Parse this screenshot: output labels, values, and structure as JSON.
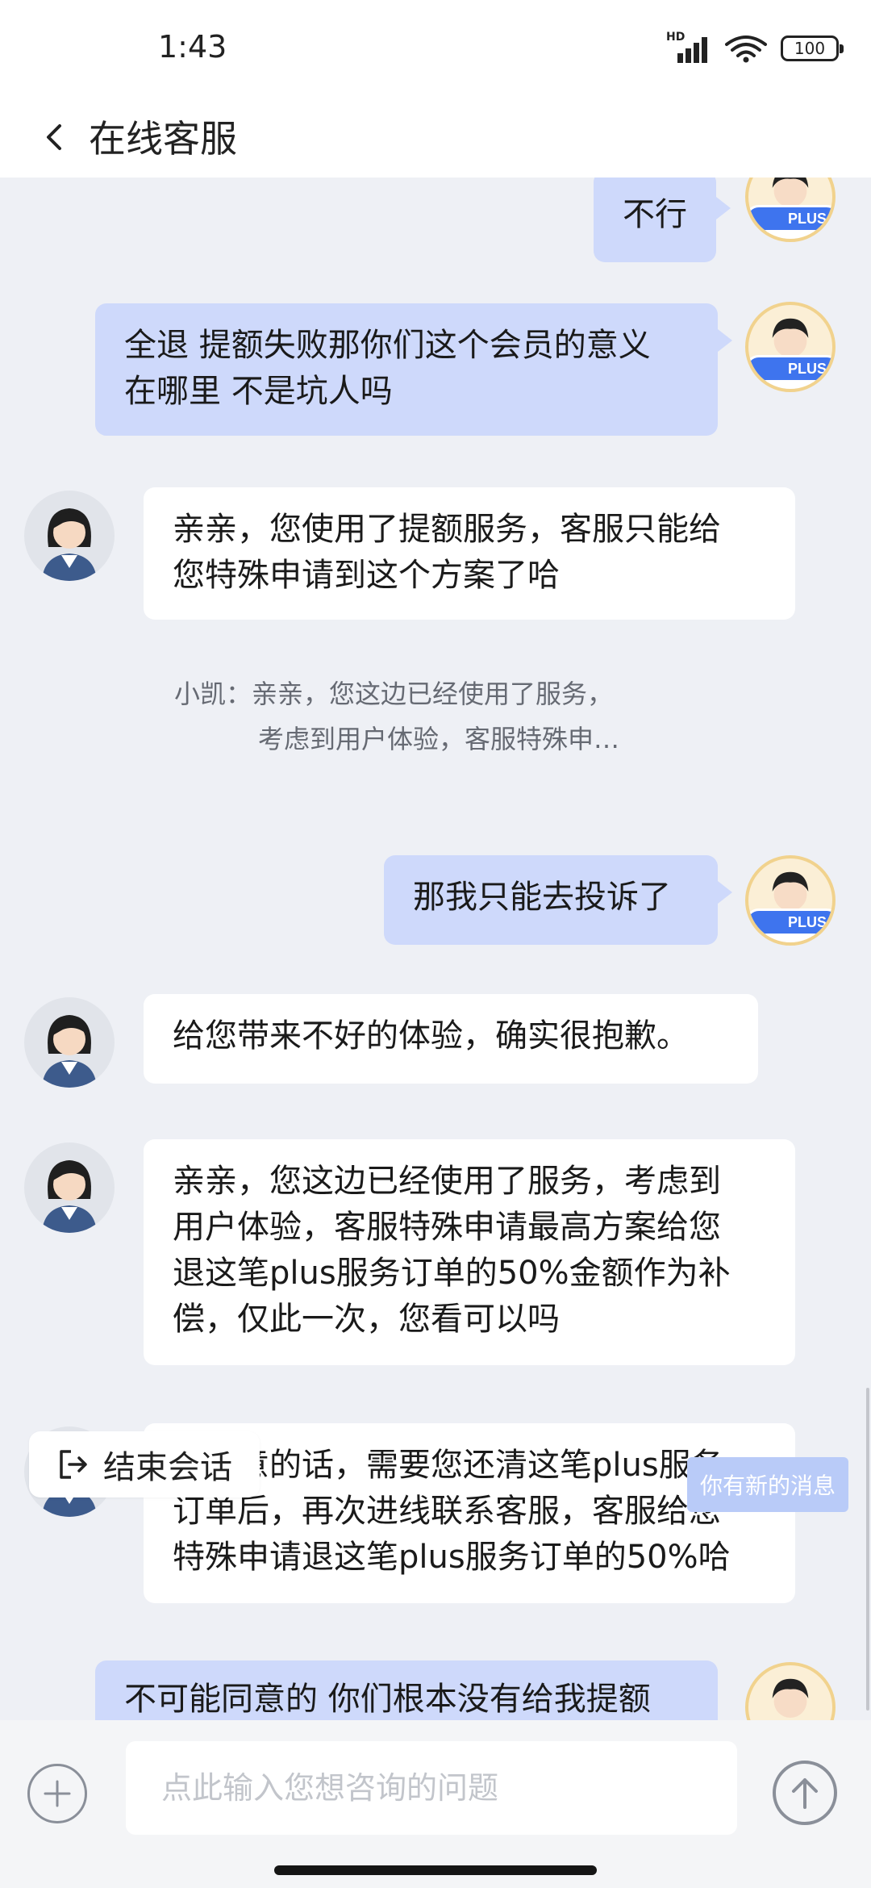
{
  "status_bar": {
    "time": "1:43",
    "network_label": "HD",
    "battery": "100",
    "icons": [
      "signal-icon",
      "wifi-icon",
      "battery-icon"
    ]
  },
  "header": {
    "back_icon": "chevron-left-icon",
    "title": "在线客服"
  },
  "messages": [
    {
      "sender": "user",
      "text": "不行"
    },
    {
      "sender": "user",
      "lines": [
        "全退 提额失败那你们这个会员的意义",
        "在哪里 不是坑人吗"
      ]
    },
    {
      "sender": "agent",
      "lines": [
        "亲亲，您使用了提额服务，客服只能给",
        "您特殊申请到这个方案了哈"
      ]
    },
    {
      "sender": "agent_quote",
      "lines": [
        "小凯：亲亲，您这边已经使用了服务，",
        "考虑到用户体验，客服特殊申…"
      ]
    },
    {
      "sender": "user",
      "text": "那我只能去投诉了"
    },
    {
      "sender": "agent",
      "text": "给您带来不好的体验，确实很抱歉。"
    },
    {
      "sender": "agent",
      "lines": [
        "亲亲，您这边已经使用了服务，考虑到",
        "用户体验，客服特殊申请最高方案给您",
        "退这笔plus服务订单的50%金额作为补",
        "偿，仅此一次，您看可以吗"
      ]
    },
    {
      "sender": "agent",
      "lines": [
        "您同意的话，需要您还清这笔plus服务",
        "订单后，再次进线联系客服，客服给您",
        "特殊申请退这笔plus服务订单的50%哈"
      ]
    },
    {
      "sender": "user",
      "text": "不可能同意的 你们根本没有给我提额"
    }
  ],
  "user_badge": "PLUS",
  "end_chat": {
    "label": "结束会话",
    "icon": "exit-icon"
  },
  "new_message_tip": "你有新的消息",
  "input": {
    "placeholder": "点此输入您想咨询的问题"
  },
  "colors": {
    "user_bubble": "#ced9fb",
    "agent_bubble": "#ffffff",
    "chat_background": "#eef0f5",
    "plus_badge": "#3e74ee"
  }
}
